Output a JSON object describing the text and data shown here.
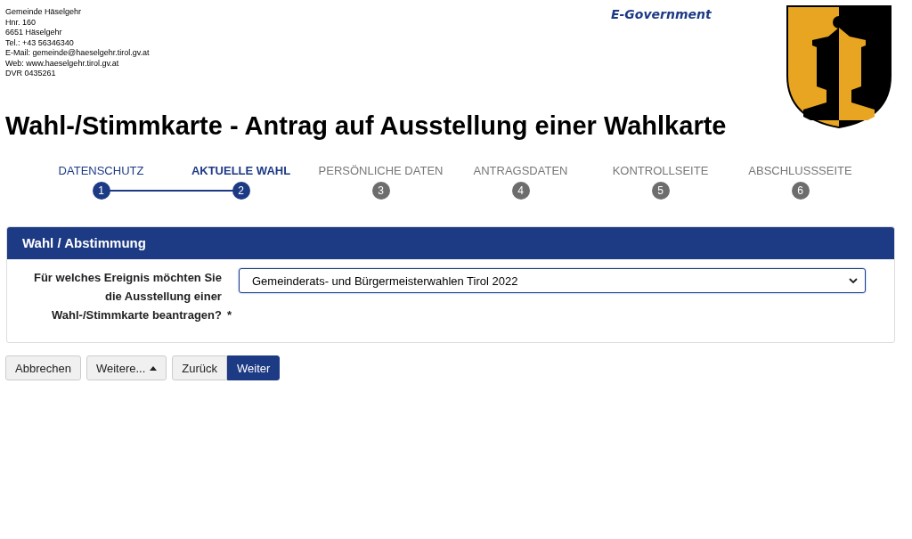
{
  "contact": [
    "Gemeinde Häselgehr",
    "Hnr. 160",
    "6651 Häselgehr",
    "Tel.: +43 56346340",
    "E-Mail: gemeinde@haeselgehr.tirol.gv.at",
    "Web: www.haeselgehr.tirol.gv.at",
    "DVR 0435261"
  ],
  "brand": "E-Government",
  "title": "Wahl-/Stimmkarte - Antrag auf Ausstellung einer Wahlkarte",
  "steps": [
    {
      "label": "DATENSCHUTZ",
      "number": "1",
      "completed": true,
      "selected": false
    },
    {
      "label": "AKTUELLE WAHL",
      "number": "2",
      "completed": false,
      "selected": true
    },
    {
      "label": "PERSÖNLICHE DATEN",
      "number": "3",
      "completed": false,
      "selected": false
    },
    {
      "label": "ANTRAGSDATEN",
      "number": "4",
      "completed": false,
      "selected": false
    },
    {
      "label": "KONTROLLSEITE",
      "number": "5",
      "completed": false,
      "selected": false
    },
    {
      "label": "ABSCHLUSSSEITE",
      "number": "6",
      "completed": false,
      "selected": false
    }
  ],
  "panel": {
    "title": "Wahl / Abstimmung",
    "field": {
      "label": "Für welches Ereignis möchten Sie die Ausstellung einer Wahl-/Stimmkarte beantragen?",
      "required_mark": "*",
      "value": "Gemeinderats- und Bürgermeisterwahlen Tirol 2022"
    }
  },
  "buttons": [
    {
      "label": "Abbrechen",
      "kind": "default",
      "caret": false,
      "group": false
    },
    {
      "label": "Weitere...",
      "kind": "default",
      "caret": true,
      "group": false
    },
    {
      "label": "Zurück",
      "kind": "default",
      "caret": false,
      "group": true
    },
    {
      "label": "Weiter",
      "kind": "primary",
      "caret": false,
      "group": true
    }
  ]
}
